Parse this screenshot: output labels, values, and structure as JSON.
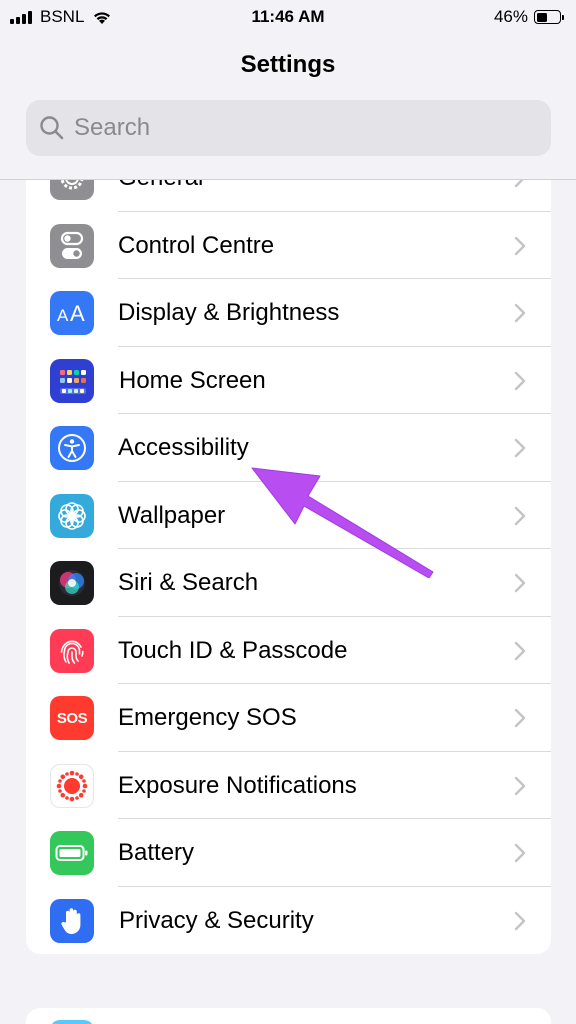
{
  "status_bar": {
    "carrier": "BSNL",
    "time": "11:46 AM",
    "battery_percent": "46%",
    "battery_level": 0.46
  },
  "header": {
    "title": "Settings",
    "search_placeholder": "Search"
  },
  "settings": {
    "items": [
      {
        "label": "General",
        "icon": "gear-icon",
        "color": "#8e8e93"
      },
      {
        "label": "Control Centre",
        "icon": "toggles-icon",
        "color": "#8e8e93"
      },
      {
        "label": "Display & Brightness",
        "icon": "text-size-icon",
        "color": "#3478f6"
      },
      {
        "label": "Home Screen",
        "icon": "app-grid-icon",
        "color": "#2e3fd1"
      },
      {
        "label": "Accessibility",
        "icon": "accessibility-icon",
        "color": "#3478f6"
      },
      {
        "label": "Wallpaper",
        "icon": "flower-icon",
        "color": "#34aadc"
      },
      {
        "label": "Siri & Search",
        "icon": "siri-icon",
        "color": "#1c1c1e"
      },
      {
        "label": "Touch ID & Passcode",
        "icon": "fingerprint-icon",
        "color": "#ff3b55"
      },
      {
        "label": "Emergency SOS",
        "icon": "sos-icon",
        "color": "#ff3b30"
      },
      {
        "label": "Exposure Notifications",
        "icon": "exposure-icon",
        "color": "#ffffff"
      },
      {
        "label": "Battery",
        "icon": "battery-icon",
        "color": "#34c759"
      },
      {
        "label": "Privacy & Security",
        "icon": "hand-icon",
        "color": "#2f6ef2"
      }
    ]
  },
  "annotation": {
    "arrow_color": "#b84df2",
    "points_to": "Accessibility"
  },
  "sos_text": "SOS"
}
